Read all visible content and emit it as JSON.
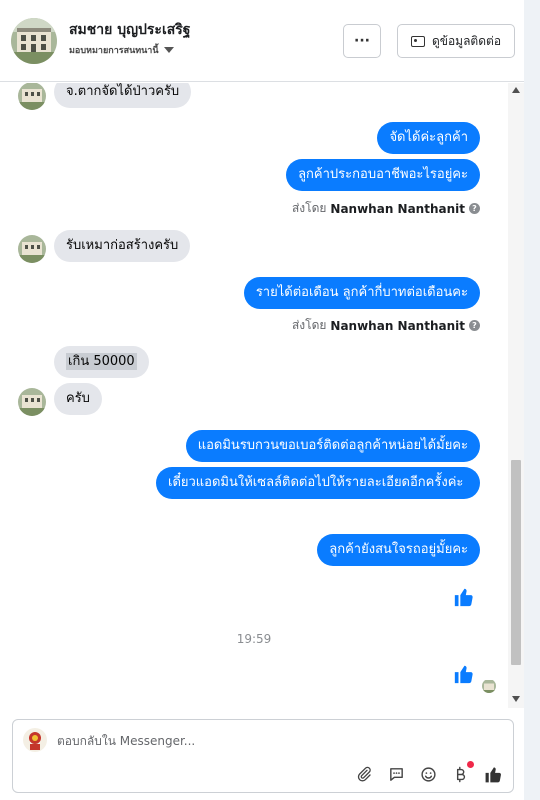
{
  "header": {
    "name": "สมชาย บุญประเสริฐ",
    "assigned_label": "มอบหมายการสนทนานี้",
    "more_label": "···",
    "contact_label": "ดูข้อมูลติดต่อ"
  },
  "messages": {
    "in_1": "จ.ตากจัดได้ป่าวครับ",
    "out_1": "จัดได้ค่ะลูกค้า",
    "out_2": "ลูกค้าประกอบอาชีพอะไรอยู่คะ",
    "sent_by_prefix_1": "ส่งโดย",
    "sent_by_name_1": "Nanwhan Nanthanit",
    "in_2": "รับเหมาก่อสร้างครับ",
    "out_3": "รายได้ต่อเดือน ลูกค้ากี่บาทต่อเดือนคะ",
    "sent_by_prefix_2": "ส่งโดย",
    "sent_by_name_2": "Nanwhan Nanthanit",
    "in_3": "เกิน  50000",
    "in_4": "ครับ",
    "out_4": "แอดมินรบกวนขอเบอร์ติดต่อลูกค้าหน่อยได้มั้ยคะ",
    "out_5": "เดี๋ยวแอดมินให้เซลล์ติดต่อไปให้รายละเอียดอีกครั้งค่ะ",
    "out_6": "ลูกค้ายังสนใจรถอยู่มั้ยคะ",
    "timestamp": "19:59",
    "info_glyph": "?"
  },
  "composer": {
    "placeholder": "ตอบกลับใน Messenger..."
  },
  "icons": {
    "attach": "paperclip-icon",
    "saved_replies": "chat-bubble-icon",
    "emoji": "smiley-icon",
    "payment": "baht-icon",
    "like": "thumbs-up-icon"
  },
  "colors": {
    "outgoing_bubble": "#0a7cff",
    "incoming_bubble": "#e4e6eb",
    "like_blue": "#0a7cff",
    "notification_dot": "#f02849"
  }
}
